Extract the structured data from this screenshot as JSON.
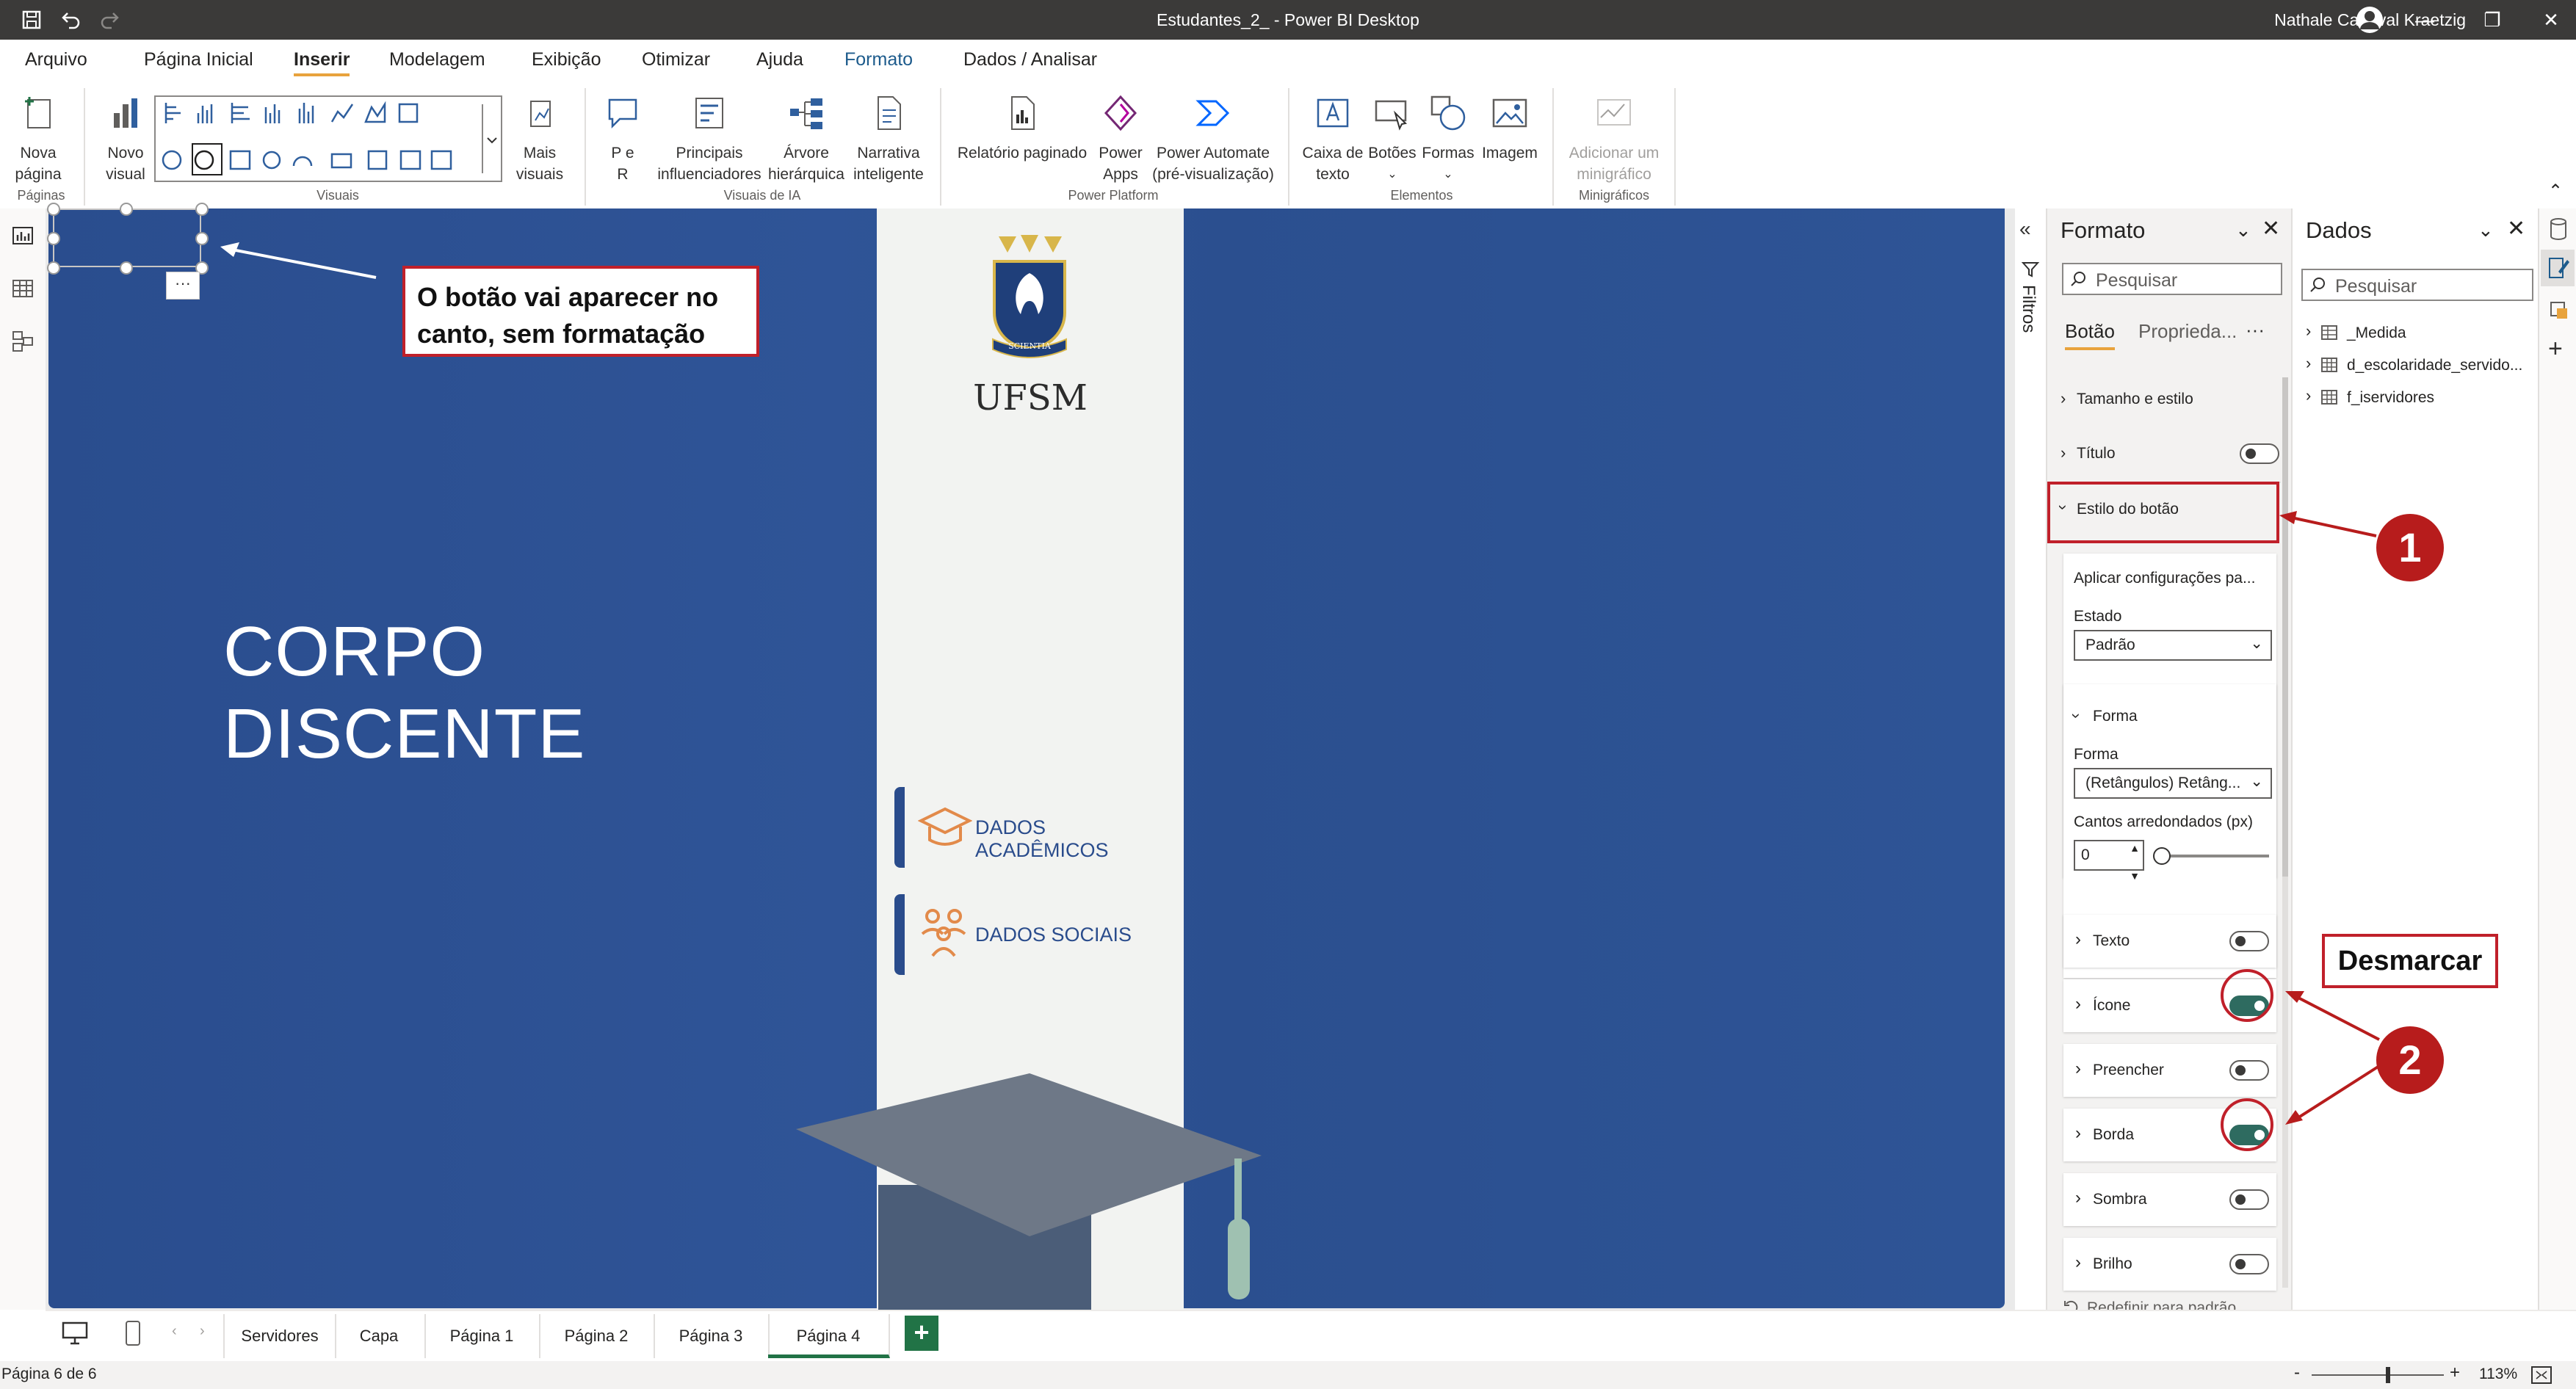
{
  "window": {
    "title": "Estudantes_2_ - Power BI Desktop",
    "user": "Nathale Cadaval Kraetzig"
  },
  "ribbon_tabs": [
    "Arquivo",
    "Página Inicial",
    "Inserir",
    "Modelagem",
    "Exibição",
    "Otimizar",
    "Ajuda",
    "Formato",
    "Dados / Analisar"
  ],
  "ribbon": {
    "nova_pagina": [
      "Nova",
      "página"
    ],
    "novo_visual": [
      "Novo",
      "visual"
    ],
    "mais_visuais": [
      "Mais",
      "visuais"
    ],
    "pe_r": [
      "P e",
      "R"
    ],
    "principais": [
      "Principais",
      "influenciadores"
    ],
    "arvore": [
      "Árvore",
      "hierárquica"
    ],
    "narrativa": [
      "Narrativa",
      "inteligente"
    ],
    "relatorio": [
      "Relatório paginado"
    ],
    "power_apps": [
      "Power",
      "Apps"
    ],
    "power_automate": [
      "Power Automate",
      "(pré-visualização)"
    ],
    "caixa_texto": [
      "Caixa de",
      "texto"
    ],
    "botoes": [
      "Botões"
    ],
    "formas": [
      "Formas"
    ],
    "imagem": [
      "Imagem"
    ],
    "minigrafico": [
      "Adicionar um",
      "minigráfico"
    ],
    "groups": {
      "paginas": "Páginas",
      "visuais": "Visuais",
      "visuais_ia": "Visuais de IA",
      "power_platform": "Power Platform",
      "elementos": "Elementos",
      "minigraficos": "Minigráficos"
    }
  },
  "canvas": {
    "title_line1": "CORPO",
    "title_line2": "DISCENTE",
    "ufsm_label": "UFSM",
    "crest_motto": "SCIENTIA",
    "nav_academicos": "DADOS ACADÊMICOS",
    "nav_sociais": "DADOS SOCIAIS",
    "more_glyph": "···"
  },
  "callouts": {
    "button_note_line1": "O botão vai aparecer no",
    "button_note_line2": "canto, sem formatação",
    "desmarcar": "Desmarcar",
    "badge1": "1",
    "badge2": "2"
  },
  "filters_label": "Filtros",
  "format_pane": {
    "title": "Formato",
    "search_placeholder": "Pesquisar",
    "tab_botao": "Botão",
    "tab_propriedades": "Proprieda...",
    "tab_more": "···",
    "tamanho_estilo": "Tamanho e estilo",
    "titulo": "Título",
    "titulo_on": false,
    "estilo_botao": "Estilo do botão",
    "aplicar": "Aplicar configurações pa...",
    "estado_label": "Estado",
    "estado_value": "Padrão",
    "forma_header": "Forma",
    "forma_label": "Forma",
    "forma_value": "(Retângulos) Retâng...",
    "cantos_label": "Cantos arredondados (px)",
    "cantos_value": "0",
    "sections": [
      {
        "label": "Texto",
        "on": false
      },
      {
        "label": "Ícone",
        "on": true
      },
      {
        "label": "Preencher",
        "on": false
      },
      {
        "label": "Borda",
        "on": true
      },
      {
        "label": "Sombra",
        "on": false
      },
      {
        "label": "Brilho",
        "on": false
      }
    ],
    "reset": "Redefinir para padrão"
  },
  "data_pane": {
    "title": "Dados",
    "search_placeholder": "Pesquisar",
    "items": [
      "_Medida",
      "d_escolaridade_servido...",
      "f_iservidores"
    ]
  },
  "page_tabs": [
    "Servidores",
    "Capa",
    "Página 1",
    "Página 2",
    "Página 3",
    "Página 4"
  ],
  "page_tabs_active": "Página 4",
  "add_page": "+",
  "status": {
    "page_info": "Página 6 de 6",
    "zoom": "113%",
    "zoom_level": 0.56
  },
  "colors": {
    "canvas_blue": "#2d5193",
    "accent_orange": "#e28a4a",
    "callout_red": "#c0202a",
    "toggle_on": "#2e6b60"
  }
}
